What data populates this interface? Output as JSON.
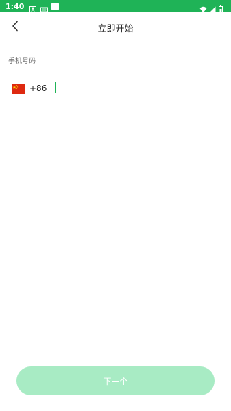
{
  "status_bar": {
    "time": "1:40",
    "background": "#1fb357",
    "icons": [
      "text-a-icon",
      "keyboard-icon",
      "notification-box-icon",
      "wifi-icon",
      "signal-icon",
      "battery-icon"
    ]
  },
  "header": {
    "title": "立即开始",
    "back_icon": "chevron-left-icon"
  },
  "form": {
    "phone_label": "手机号码",
    "country_flag": "china-flag-icon",
    "country_code": "+86",
    "phone_value": "",
    "phone_placeholder": ""
  },
  "footer": {
    "next_label": "下一个",
    "next_button_color": "#a8ebc4"
  },
  "colors": {
    "accent": "#1fb357"
  }
}
